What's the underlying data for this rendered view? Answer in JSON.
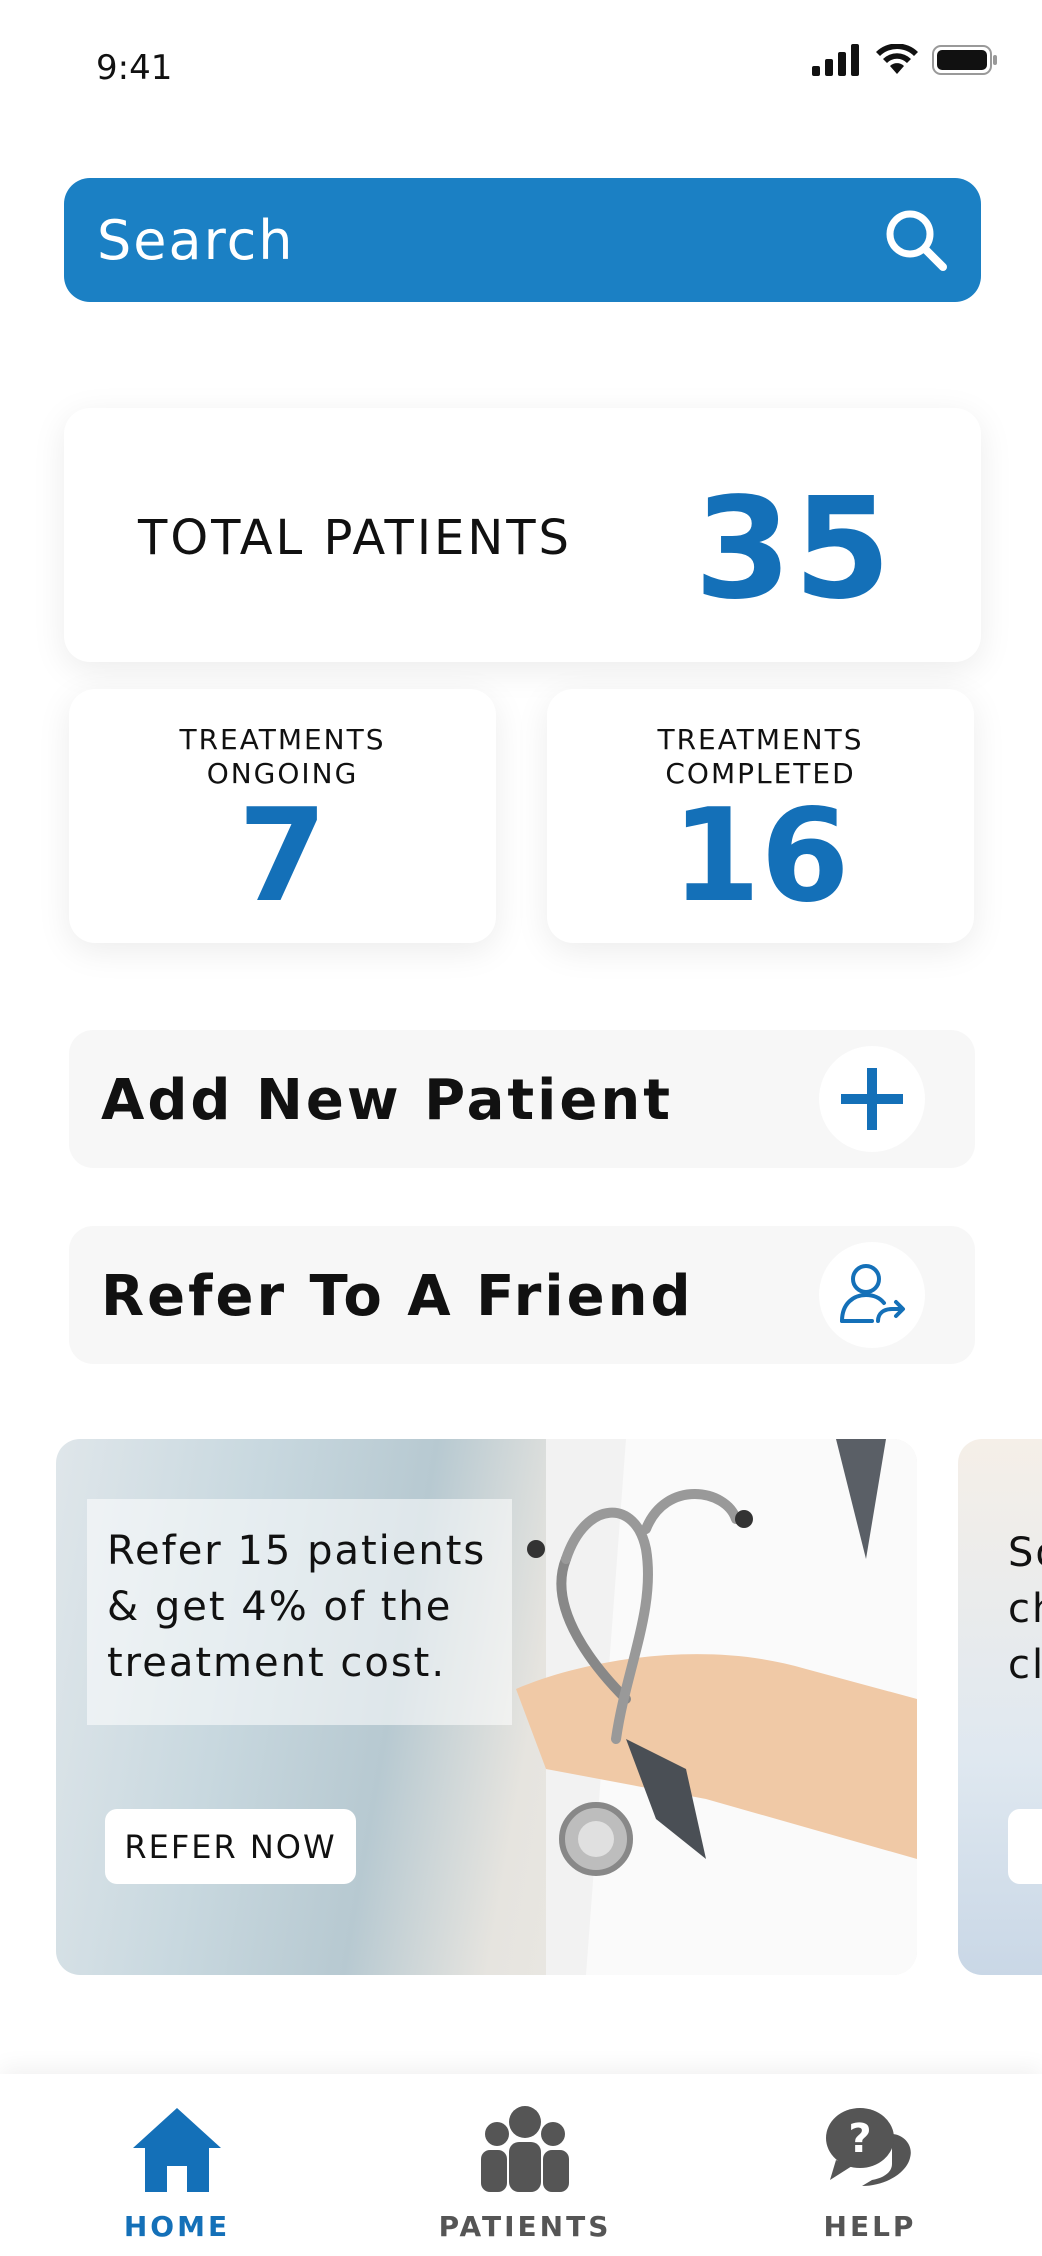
{
  "status_bar": {
    "time": "9:41"
  },
  "search": {
    "placeholder": "Search"
  },
  "stats": {
    "total_label": "TOTAL PATIENTS",
    "total_value": "35",
    "ongoing_label_line1": "TREATMENTS",
    "ongoing_label_line2": "ONGOING",
    "ongoing_value": "7",
    "completed_label_line1": "TREATMENTS",
    "completed_label_line2": "COMPLETED",
    "completed_value": "16"
  },
  "actions": {
    "add_patient": "Add New Patient",
    "refer_friend": "Refer To A Friend"
  },
  "promo": {
    "text": "Refer 15 patients & get 4% of the treatment cost.",
    "button": "REFER NOW",
    "next_card_text": "So\nch\ncl"
  },
  "bottom_nav": {
    "home": "HOME",
    "patients": "PATIENTS",
    "help": "HELP"
  },
  "colors": {
    "accent": "#1b80c4",
    "accent_dark": "#1470b8",
    "inactive": "#555555"
  },
  "icons": {
    "search": "search-icon",
    "add": "plus-icon",
    "refer": "user-share-icon",
    "home": "home-icon",
    "patients": "people-icon",
    "help": "help-chat-icon"
  }
}
